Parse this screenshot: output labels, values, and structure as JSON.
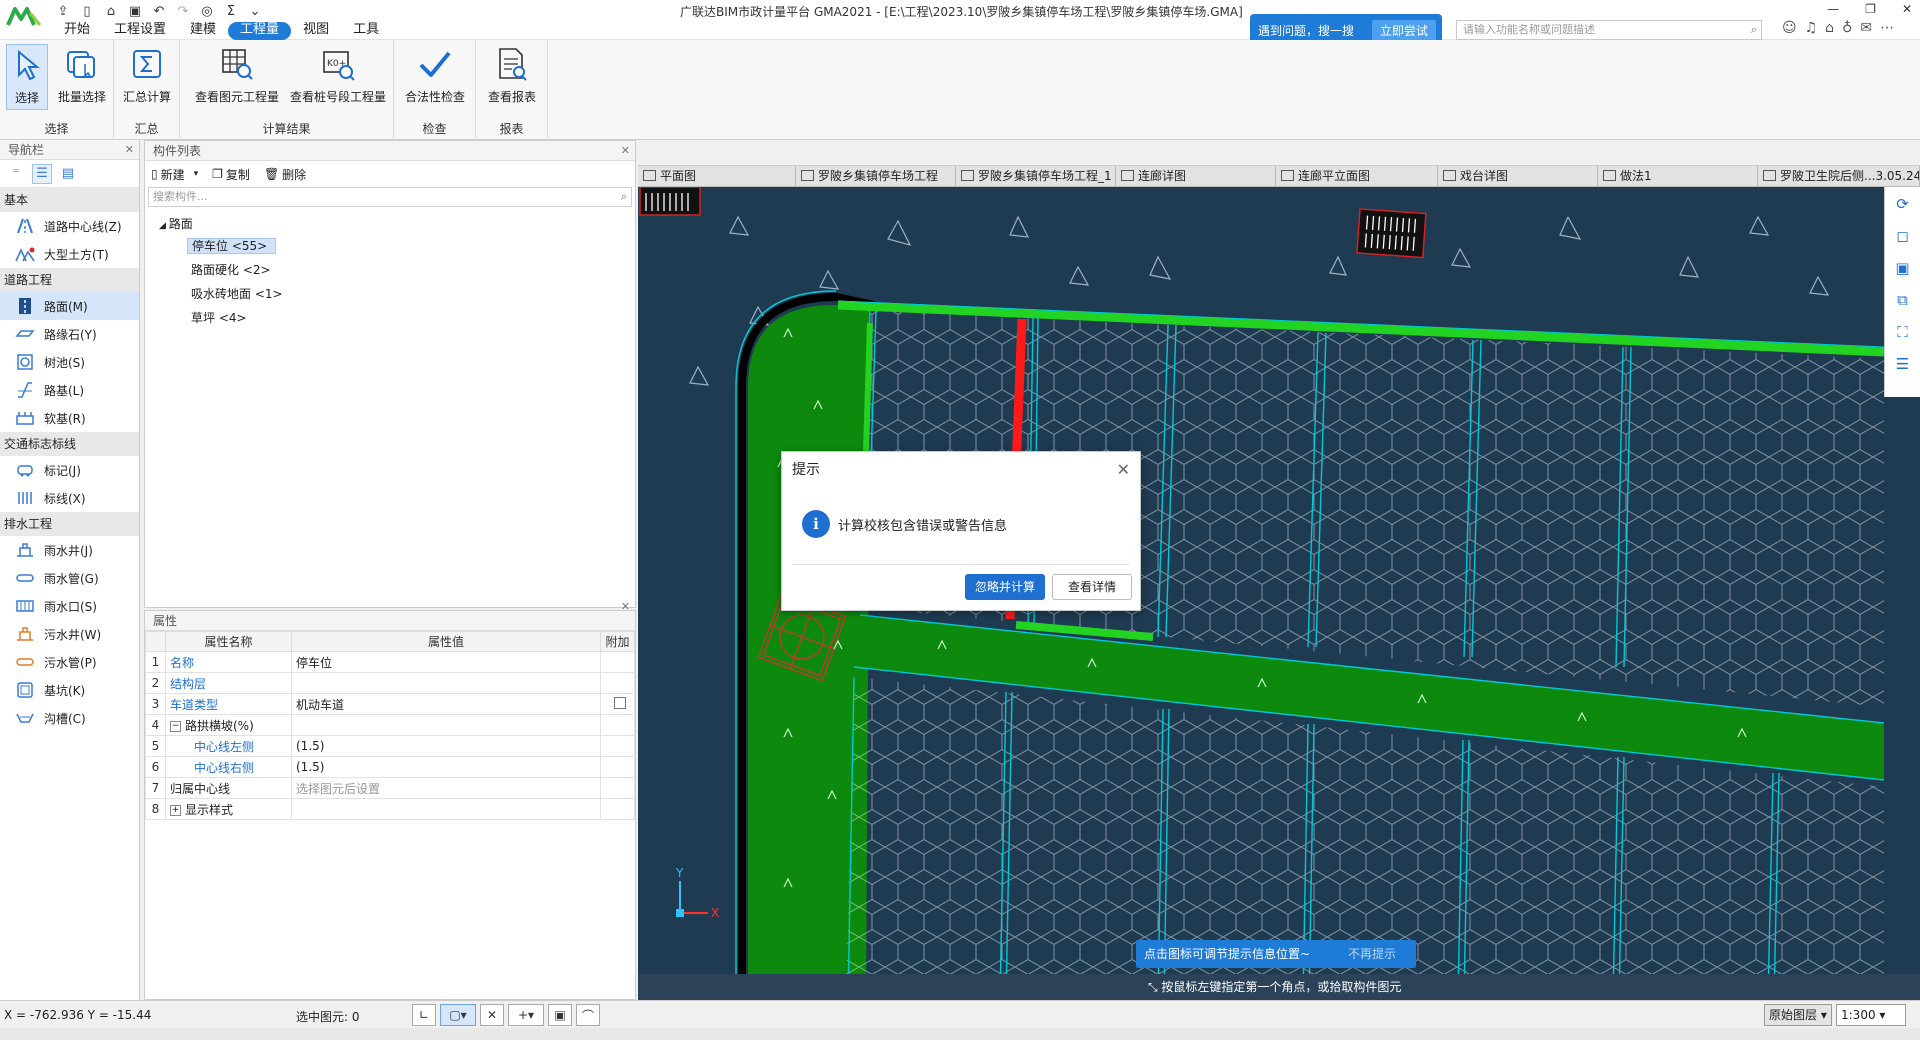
{
  "window": {
    "title": "广联达BIM市政计量平台 GMA2021 - [E:\\工程\\2023.10\\罗陂乡集镇停车场工程\\罗陂乡集镇停车场.GMA]",
    "minimize": "—",
    "restore": "❐",
    "close": "✕"
  },
  "menu": [
    "开始",
    "工程设置",
    "建模",
    "工程量",
    "视图",
    "工具"
  ],
  "help": {
    "text": "遇到问题，搜一搜",
    "try": "立即尝试",
    "search_placeholder": "请输入功能名称或问题描述"
  },
  "ribbon": {
    "groups": [
      {
        "label": "选择",
        "buttons": [
          "选择",
          "批量选择"
        ]
      },
      {
        "label": "汇总",
        "buttons": [
          "汇总计算"
        ]
      },
      {
        "label": "计算结果",
        "buttons": [
          "查看图元工程量",
          "查看桩号段工程量"
        ]
      },
      {
        "label": "检查",
        "buttons": [
          "合法性检查"
        ]
      },
      {
        "label": "报表",
        "buttons": [
          "查看报表"
        ]
      }
    ],
    "k0_badge": "K0+"
  },
  "nav": {
    "title": "导航栏",
    "categories": [
      {
        "name": "基本",
        "items": [
          "道路中心线(Z)",
          "大型土方(T)"
        ]
      },
      {
        "name": "道路工程",
        "items": [
          "路面(M)",
          "路缘石(Y)",
          "树池(S)",
          "路基(L)",
          "软基(R)"
        ]
      },
      {
        "name": "交通标志标线",
        "items": [
          "标记(J)",
          "标线(X)"
        ]
      },
      {
        "name": "排水工程",
        "items": [
          "雨水井(J)",
          "雨水管(G)",
          "雨水口(S)",
          "污水井(W)",
          "污水管(P)",
          "基坑(K)",
          "沟槽(C)"
        ]
      }
    ]
  },
  "complist": {
    "title": "构件列表",
    "new": "新建",
    "copy": "复制",
    "delete": "删除",
    "search_placeholder": "搜索构件...",
    "root": "路面",
    "items": [
      "停车位 <55>",
      "路面硬化 <2>",
      "吸水砖地面 <1>",
      "草坪 <4>"
    ]
  },
  "props": {
    "title": "属性",
    "headers": [
      "属性名称",
      "属性值",
      "附加"
    ],
    "rows": [
      {
        "n": "1",
        "name": "名称",
        "value": ""
      },
      {
        "n": "2",
        "name": "结构层",
        "value": ""
      },
      {
        "n": "3",
        "name": "车道类型",
        "value": "机动车道"
      },
      {
        "n": "4",
        "name": "路拱横坡(%)",
        "value": ""
      },
      {
        "n": "5",
        "name": "中心线左侧",
        "value": "(1.5)"
      },
      {
        "n": "6",
        "name": "中心线右侧",
        "value": "(1.5)"
      },
      {
        "n": "7",
        "name": "归属中心线",
        "value": "选择图元后设置"
      },
      {
        "n": "8",
        "name": "显示样式",
        "value": ""
      }
    ],
    "name_value": "停车位"
  },
  "tabs": [
    "平面图",
    "罗陂乡集镇停车场工程",
    "罗陂乡集镇停车场工程_1",
    "连廊详图",
    "连廊平立面图",
    "戏台详图",
    "做法1",
    "罗陂卫生院后侧...3.05.24"
  ],
  "dialog": {
    "title": "提示",
    "message": "计算校核包含错误或警告信息",
    "btn_primary": "忽略并计算",
    "btn_secondary": "查看详情",
    "info_glyph": "i"
  },
  "tipbar": {
    "text": "点击图标可调节提示信息位置~",
    "dismiss": "不再提示"
  },
  "command": "按鼠标左键指定第一个角点，或拾取构件图元",
  "status": {
    "coords": "X = -762.936 Y = -15.44",
    "selected": "选中图元:  0",
    "layer": "原始图层",
    "scale": "1:300"
  },
  "axis": {
    "x": "X",
    "y": "Y"
  },
  "colors": {
    "accent": "#1f7bd8",
    "canvas": "#1f3b52",
    "grass": "#0d8a0d",
    "green_line": "#22d322",
    "red_line": "#ff1a1a",
    "cyan_line": "#00c8d8"
  }
}
